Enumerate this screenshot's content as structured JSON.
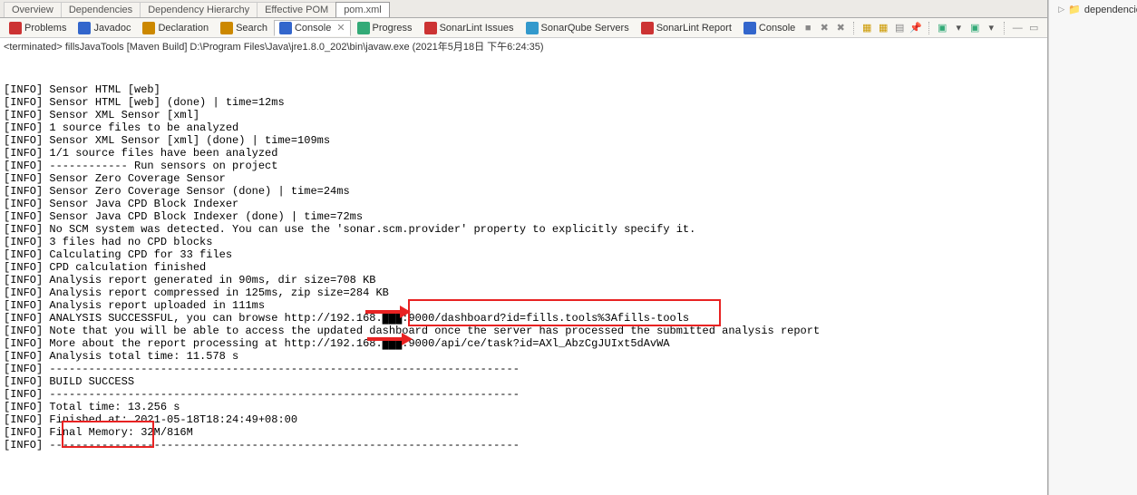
{
  "editor_tabs": [
    {
      "label": "Overview"
    },
    {
      "label": "Dependencies"
    },
    {
      "label": "Dependency Hierarchy"
    },
    {
      "label": "Effective POM"
    },
    {
      "label": "pom.xml",
      "active": true
    }
  ],
  "views": [
    {
      "id": "problems",
      "label": "Problems"
    },
    {
      "id": "javadoc",
      "label": "Javadoc"
    },
    {
      "id": "declaration",
      "label": "Declaration"
    },
    {
      "id": "search",
      "label": "Search"
    },
    {
      "id": "console",
      "label": "Console",
      "active": true
    },
    {
      "id": "progress",
      "label": "Progress"
    },
    {
      "id": "slissues",
      "label": "SonarLint Issues"
    },
    {
      "id": "sqservers",
      "label": "SonarQube Servers"
    },
    {
      "id": "slreport",
      "label": "SonarLint Report"
    },
    {
      "id": "console2",
      "label": "Console"
    }
  ],
  "status": "<terminated> fillsJavaTools [Maven Build] D:\\Program Files\\Java\\jre1.8.0_202\\bin\\javaw.exe (2021年5月18日 下午6:24:35)",
  "side": {
    "item1": "dependencies"
  },
  "console": {
    "lines": [
      "[INFO] Sensor HTML [web]",
      "[INFO] Sensor HTML [web] (done) | time=12ms",
      "[INFO] Sensor XML Sensor [xml]",
      "[INFO] 1 source files to be analyzed",
      "[INFO] Sensor XML Sensor [xml] (done) | time=109ms",
      "[INFO] 1/1 source files have been analyzed",
      "[INFO] ------------ Run sensors on project",
      "[INFO] Sensor Zero Coverage Sensor",
      "[INFO] Sensor Zero Coverage Sensor (done) | time=24ms",
      "[INFO] Sensor Java CPD Block Indexer",
      "[INFO] Sensor Java CPD Block Indexer (done) | time=72ms",
      "[INFO] No SCM system was detected. You can use the 'sonar.scm.provider' property to explicitly specify it.",
      "[INFO] 3 files had no CPD blocks",
      "[INFO] Calculating CPD for 33 files",
      "[INFO] CPD calculation finished",
      "[INFO] Analysis report generated in 90ms, dir size=708 KB",
      "[INFO] Analysis report compressed in 125ms, zip size=284 KB",
      "[INFO] Analysis report uploaded in 111ms",
      "[INFO] ANALYSIS SUCCESSFUL, you can browse http://192.168.███:9000/dashboard?id=fills.tools%3Afills-tools",
      "[INFO] Note that you will be able to access the updated dashboard once the server has processed the submitted analysis report",
      "[INFO] More about the report processing at http://192.168.███:9000/api/ce/task?id=AXl_AbzCgJUIxt5dAvWA",
      "[INFO] Analysis total time: 11.578 s",
      "[INFO] ------------------------------------------------------------------------",
      "[INFO] BUILD SUCCESS",
      "[INFO] ------------------------------------------------------------------------",
      "[INFO] Total time: 13.256 s",
      "[INFO] Finished at: 2021-05-18T18:24:49+08:00",
      "[INFO] Final Memory: 32M/816M",
      "[INFO] ------------------------------------------------------------------------"
    ]
  },
  "toolbar_icons": [
    "remove-all-icon",
    "remove-icon",
    "lock-icon",
    "sep",
    "scroll-icon",
    "pin-icon",
    "minimize-icon",
    "sep",
    "display-icon",
    "terminal-icon",
    "sep",
    "open-icon",
    "dropdown-icon"
  ]
}
